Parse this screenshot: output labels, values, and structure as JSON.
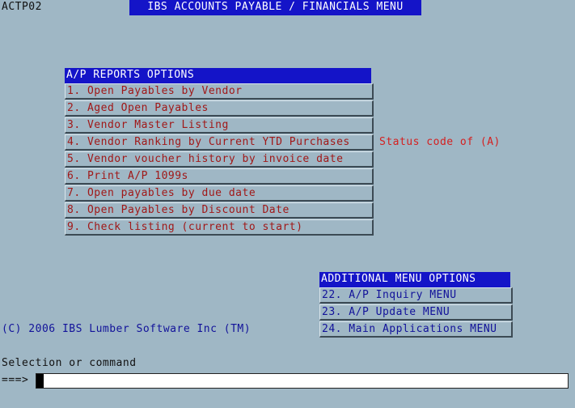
{
  "program_id": "ACTP02",
  "title": "IBS ACCOUNTS PAYABLE / FINANCIALS MENU",
  "reports": {
    "header": "A/P REPORTS OPTIONS",
    "items": [
      {
        "label": "1. Open Payables by Vendor"
      },
      {
        "label": "2. Aged Open Payables"
      },
      {
        "label": "3. Vendor Master Listing"
      },
      {
        "label": "4. Vendor Ranking by Current YTD Purchases"
      },
      {
        "label": "5. Vendor voucher history by invoice date"
      },
      {
        "label": "6. Print A/P 1099s"
      },
      {
        "label": "7. Open payables by due date"
      },
      {
        "label": "8. Open Payables by Discount Date"
      },
      {
        "label": "9. Check listing (current to start)"
      }
    ]
  },
  "status_note": "Status code of (A)",
  "additional": {
    "header": "ADDITIONAL MENU OPTIONS",
    "items": [
      {
        "label": "22. A/P Inquiry MENU"
      },
      {
        "label": "23. A/P Update MENU"
      },
      {
        "label": "24. Main Applications MENU"
      }
    ]
  },
  "copyright": "(C) 2006 IBS Lumber Software Inc (TM)",
  "command": {
    "label": "Selection or command",
    "prompt": "===>",
    "value": ""
  },
  "colors": {
    "background": "#9fb7c5",
    "header_blue": "#1414c8",
    "option_red": "#a01818",
    "option_blue": "#12129a",
    "status_red": "#d42020"
  }
}
